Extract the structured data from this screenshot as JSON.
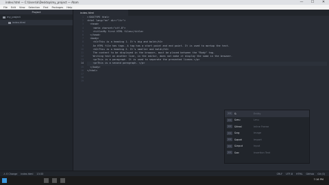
{
  "window": {
    "title": "index.html — C:\\Users\\k\\Desktop\\my_project — Atom",
    "controls": [
      "—",
      "☐",
      "✕"
    ]
  },
  "menu": [
    "File",
    "Edit",
    "View",
    "Selection",
    "Find",
    "Packages",
    "Help"
  ],
  "sidebar": {
    "header": "Project",
    "folder": "my_project",
    "file": "index.html"
  },
  "tab": "index.html",
  "gutter": [
    "1",
    "2",
    "3",
    "4",
    "5",
    "6",
    "7",
    "8",
    "9",
    "10",
    "11",
    "12",
    "13",
    "14",
    "15",
    "16",
    "17",
    "18",
    "19"
  ],
  "code_lines": [
    "<!DOCTYPE html>",
    "<html lang=\"en\" dir=\"ltr\">",
    "  <head>",
    "    <meta charset=\"utf-8\">",
    "    <title>My first HTML files</title>",
    "  </head>",
    "  <body>",
    "    <h1>This is a heading 1. It's big and bold</h1>",
    "    An HTML file has tags. A tag has a start point and end point. It is used to markup the text.",
    "    <h2>This is a heading 2. It's smaller and bold</h2>",
    "    The content to be displayed in the browser, must be placed between the \"Body\" tag.",
    "    Writing text on another line, in the editor, does not make it display the same in the browser.",
    "    <p>This is a paragraph. It is used to separate the presented lineas.</p>",
    "    <p>This is a second paragraph. </p>",
    "  </body>",
    "</html>",
    "",
    "",
    ""
  ],
  "autocomplete": [
    {
      "badge": "<>",
      "kw": "&",
      "desc": "Entity"
    },
    {
      "badge": "<>",
      "kw": "&mu",
      "desc": "Lmu"
    },
    {
      "badge": "<>",
      "kw": "&frasl",
      "desc": "Inline Frame"
    },
    {
      "badge": "<>",
      "kw": "&ng",
      "desc": "Image"
    },
    {
      "badge": "<>",
      "kw": "&quot",
      "desc": "Import"
    },
    {
      "badge": "<>",
      "kw": "&input",
      "desc": "Input"
    },
    {
      "badge": "<>",
      "kw": "&ac",
      "desc": "Insertion Text"
    }
  ],
  "status": {
    "left": [
      "⚠ 0 Change",
      "index.html",
      "13:33"
    ],
    "right": [
      "CRLF",
      "UTF-8",
      "HTML",
      "GitHub",
      "Git (0)"
    ]
  },
  "taskbar": {
    "clock": "7:16 PM"
  }
}
